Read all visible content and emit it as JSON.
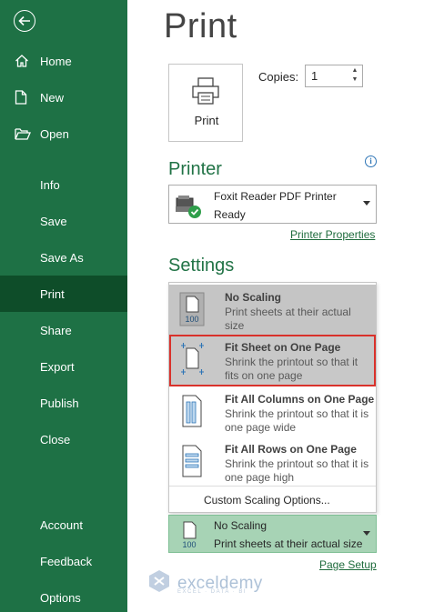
{
  "sidebar": {
    "bg_color": "#1e7145",
    "active_color": "#0e4d29",
    "items": [
      {
        "label": "Home",
        "icon": "home-icon"
      },
      {
        "label": "New",
        "icon": "new-document-icon"
      },
      {
        "label": "Open",
        "icon": "open-folder-icon"
      },
      {
        "label": "Info"
      },
      {
        "label": "Save"
      },
      {
        "label": "Save As"
      },
      {
        "label": "Print",
        "active": true
      },
      {
        "label": "Share"
      },
      {
        "label": "Export"
      },
      {
        "label": "Publish"
      },
      {
        "label": "Close"
      },
      {
        "label": "Account"
      },
      {
        "label": "Feedback"
      },
      {
        "label": "Options"
      }
    ]
  },
  "page_title": "Print",
  "print_button": {
    "label": "Print",
    "icon": "printer-icon"
  },
  "copies": {
    "label": "Copies:",
    "value": "1"
  },
  "printer": {
    "heading": "Printer",
    "name": "Foxit Reader PDF Printer",
    "status": "Ready",
    "properties_link": "Printer Properties"
  },
  "settings": {
    "heading": "Settings",
    "scaling_menu": [
      {
        "title": "No Scaling",
        "desc": "Print sheets at their actual size",
        "icon_text": "100",
        "selected": true
      },
      {
        "title": "Fit Sheet on One Page",
        "desc": "Shrink the printout so that it fits on one page",
        "highlighted": true
      },
      {
        "title": "Fit All Columns on One Page",
        "desc": "Shrink the printout so that it is one page wide"
      },
      {
        "title": "Fit All Rows on One Page",
        "desc": "Shrink the printout so that it is one page high"
      }
    ],
    "custom_option": "Custom Scaling Options...",
    "current": {
      "title": "No Scaling",
      "desc": "Print sheets at their actual size",
      "icon_text": "100"
    },
    "page_setup_link": "Page Setup"
  },
  "watermark": {
    "name": "exceldemy",
    "tagline": "EXCEL · DATA · BI"
  }
}
